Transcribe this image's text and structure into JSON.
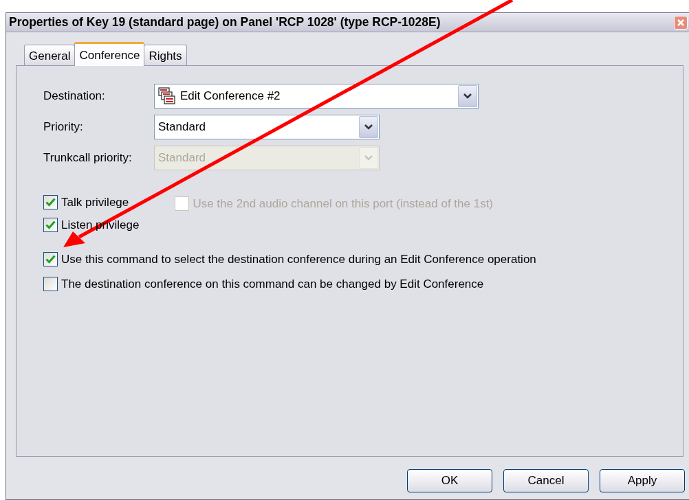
{
  "window": {
    "title": "Properties of Key 19 (standard page) on Panel 'RCP 1028' (type RCP-1028E)"
  },
  "tabs": [
    {
      "label": "General",
      "selected": false
    },
    {
      "label": "Conference",
      "selected": true
    },
    {
      "label": "Rights",
      "selected": false
    }
  ],
  "fields": [
    {
      "kind": "conference",
      "label": "Destination:",
      "value": "Edit Conference #2",
      "disabled": false
    },
    {
      "kind": "plain",
      "label": "Priority:",
      "value": "Standard",
      "disabled": false
    },
    {
      "kind": "plain",
      "label": "Trunkcall priority:",
      "value": "Standard",
      "disabled": true
    }
  ],
  "privileges": [
    {
      "label": "Talk privilege",
      "checked": true,
      "disabled": false
    },
    {
      "label": "Listen privilege",
      "checked": true,
      "disabled": false
    }
  ],
  "audio_channel_option": {
    "label": "Use the 2nd audio channel on this port (instead of the 1st)",
    "checked": false,
    "disabled": true
  },
  "options": [
    {
      "label": "Use this command to select the destination conference during an Edit Conference operation",
      "checked": true,
      "disabled": false
    },
    {
      "label": "The destination conference on this command can be changed by Edit Conference",
      "checked": false,
      "disabled": false
    }
  ],
  "buttons": [
    "OK",
    "Cancel",
    "Apply"
  ]
}
